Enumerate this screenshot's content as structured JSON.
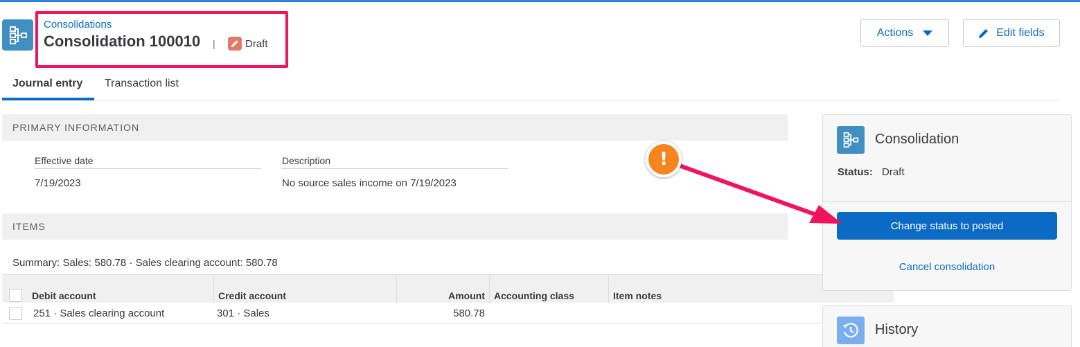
{
  "header": {
    "breadcrumb": "Consolidations",
    "title": "Consolidation 100010",
    "separator": "|",
    "status_label": "Draft",
    "actions_label": "Actions",
    "edit_fields_label": "Edit fields"
  },
  "tabs": [
    {
      "label": "Journal entry",
      "active": true
    },
    {
      "label": "Transaction list",
      "active": false
    }
  ],
  "primary_information": {
    "header": "PRIMARY INFORMATION",
    "effective_date_label": "Effective date",
    "effective_date_value": "7/19/2023",
    "description_label": "Description",
    "description_value": "No source sales income on 7/19/2023"
  },
  "items": {
    "header": "ITEMS",
    "summary": "Summary: Sales: 580.78 · Sales clearing account: 580.78",
    "columns": [
      "Debit account",
      "Credit account",
      "Amount",
      "Accounting class",
      "Item notes"
    ],
    "rows": [
      {
        "debit": "251 · Sales clearing account",
        "credit": "301 · Sales",
        "amount": "580.78",
        "accounting_class": "",
        "notes": ""
      }
    ]
  },
  "side_panel": {
    "title": "Consolidation",
    "status_key": "Status:",
    "status_value": "Draft",
    "primary_button": "Change status to posted",
    "cancel_link": "Cancel consolidation"
  },
  "history_panel": {
    "title": "History"
  },
  "annotation": {
    "badge_text": "!"
  },
  "colors": {
    "accent": "#0b6ac4",
    "highlight": "#f0145c",
    "warning": "#f5861f"
  }
}
